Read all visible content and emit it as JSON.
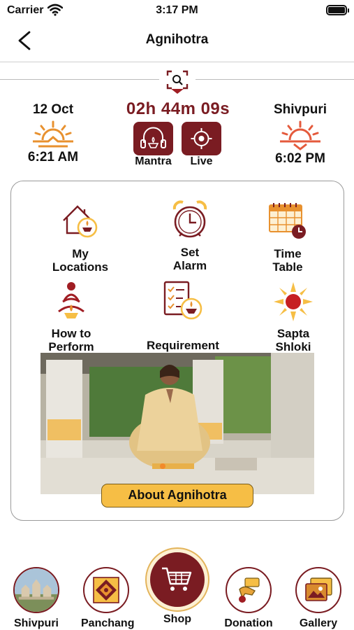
{
  "status": {
    "carrier": "Carrier",
    "time": "3:17 PM"
  },
  "nav": {
    "title": "Agnihotra"
  },
  "sunrise": {
    "date": "12 Oct",
    "time": "6:21 AM"
  },
  "sunset": {
    "place": "Shivpuri",
    "time": "6:02 PM"
  },
  "countdown": "02h 44m 09s",
  "quick": {
    "mantra": "Mantra",
    "live": "Live"
  },
  "tiles": {
    "locations": [
      "My",
      "Locations"
    ],
    "alarm": [
      "Set",
      "Alarm"
    ],
    "timetable": [
      "Time",
      "Table"
    ],
    "perform": [
      "How to",
      "Perform"
    ],
    "requirement": "Requirement",
    "sapta": [
      "Sapta",
      "Shloki"
    ]
  },
  "about_button": "About Agnihotra",
  "bottom": {
    "shivpuri": "Shivpuri",
    "panchang": "Panchang",
    "shop": "Shop",
    "donation": "Donation",
    "gallery": "Gallery"
  },
  "colors": {
    "maroon": "#7a1c22",
    "orange": "#e8912f",
    "yellow": "#f6be45"
  }
}
